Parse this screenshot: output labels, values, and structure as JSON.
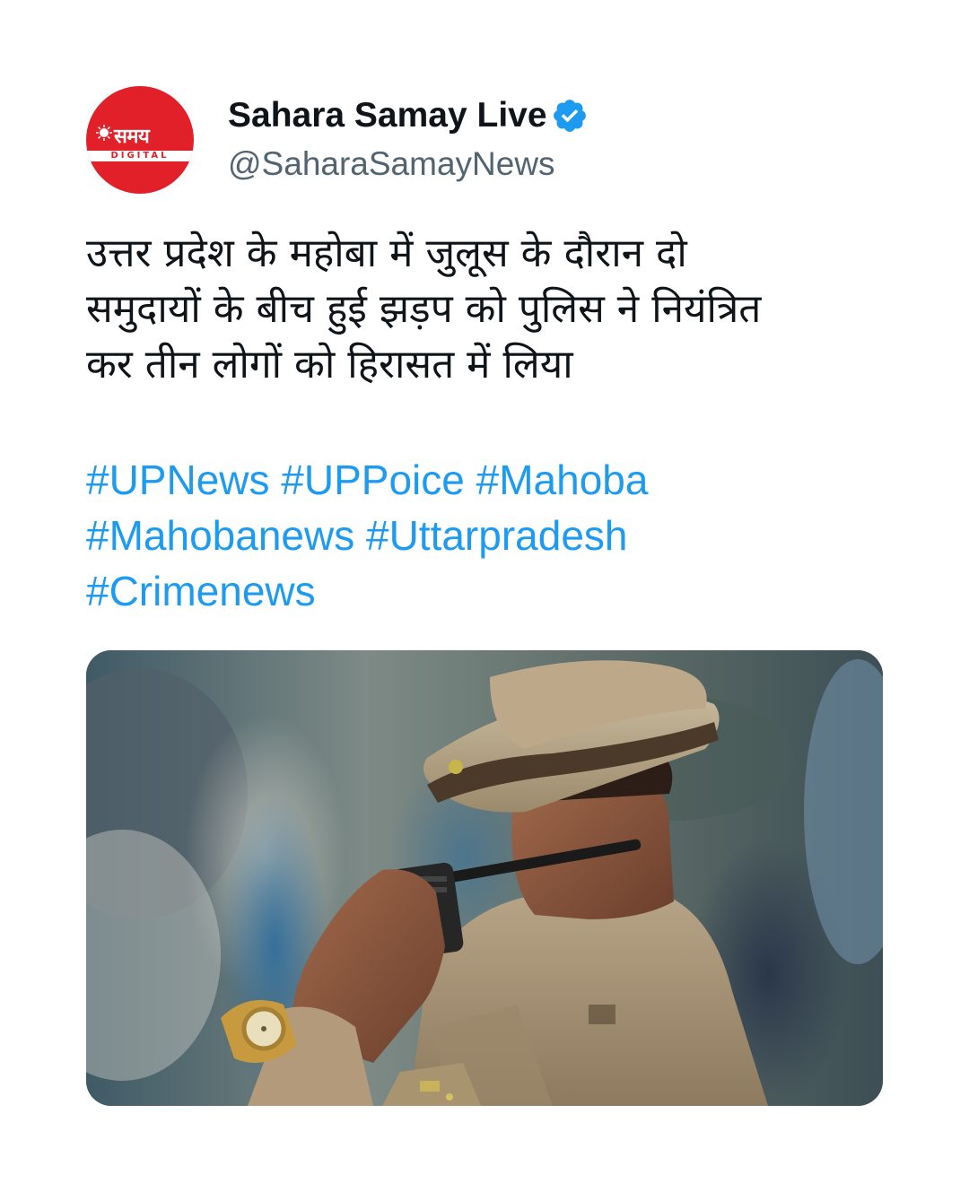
{
  "tweet": {
    "author": {
      "display_name": "Sahara Samay Live",
      "handle": "@SaharaSamayNews",
      "verified": true,
      "avatar": {
        "logo_text": "समय",
        "logo_subtext": "DIGITAL",
        "background_color": "#e2202a"
      }
    },
    "text_lines": [
      "उत्तर प्रदेश के महोबा में जुलूस के दौरान दो",
      "समुदायों के बीच हुई झड़प को पुलिस ने नियंत्रित",
      "कर तीन लोगों को हिरासत में लिया"
    ],
    "hashtags": [
      [
        "#UPNews",
        "#UPPoice",
        "#Mahoba"
      ],
      [
        "#Mahobanews",
        "#Uttarpradesh"
      ],
      [
        "#Crimenews"
      ]
    ],
    "media": {
      "icon": "police-officer-photo"
    },
    "colors": {
      "hashtag": "#1d9bf0",
      "verified_badge": "#1d9bf0",
      "handle": "#536471",
      "text": "#0f1419"
    }
  }
}
